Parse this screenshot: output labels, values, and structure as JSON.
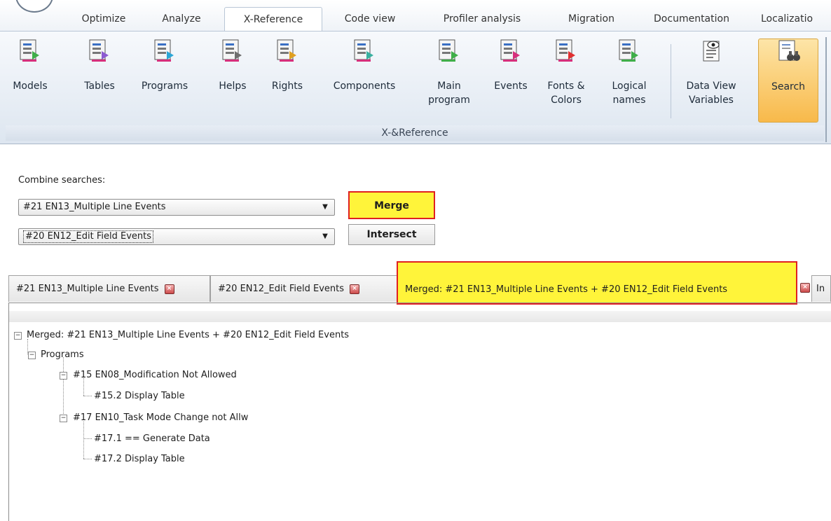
{
  "ribbon_tabs": [
    "Optimize",
    "Analyze",
    "X-Reference",
    "Code view",
    "Profiler analysis",
    "Migration",
    "Documentation",
    "Localizatio"
  ],
  "active_tab": "X-Reference",
  "ribbon_buttons": [
    {
      "label": "Models"
    },
    {
      "label": "Tables"
    },
    {
      "label": "Programs"
    },
    {
      "label": "Helps"
    },
    {
      "label": "Rights"
    },
    {
      "label": "Components"
    },
    {
      "label": "Main\nprogram"
    },
    {
      "label": "Events"
    },
    {
      "label": "Fonts &\nColors"
    },
    {
      "label": "Logical\nnames"
    },
    {
      "label": "Data View\nVariables"
    },
    {
      "label": "Search"
    }
  ],
  "ribbon_group_label": "X-&Reference",
  "combine": {
    "label": "Combine searches:",
    "first_value": "#21 EN13_Multiple Line Events",
    "second_value": "#20 EN12_Edit Field Events",
    "merge_label": "Merge",
    "intersect_label": "Intersect"
  },
  "doc_tabs": [
    {
      "label": "#21 EN13_Multiple Line Events"
    },
    {
      "label": "#20 EN12_Edit Field Events"
    },
    {
      "label": "Merged: #21 EN13_Multiple Line Events + #20 EN12_Edit Field Events"
    },
    {
      "label": "In"
    }
  ],
  "tree": {
    "root": "Merged: #21 EN13_Multiple Line Events + #20 EN12_Edit Field Events",
    "group": "Programs",
    "prog1": "#15 EN08_Modification Not Allowed",
    "prog1_task1": "#15.2 Display Table",
    "prog2": "#17 EN10_Task Mode Change not Allw",
    "prog2_task1": "#17.1 == Generate Data",
    "prog2_task2": "#17.2 Display Table"
  },
  "colors": {
    "highlight": "#fff43a",
    "highlight_border": "#e02020",
    "selected_ribbon": "#f8b94a"
  },
  "icons": [
    "app-orb-icon",
    "document-list-icon",
    "binoculars-search-icon",
    "close-tab-icon",
    "tree-collapse-icon"
  ]
}
